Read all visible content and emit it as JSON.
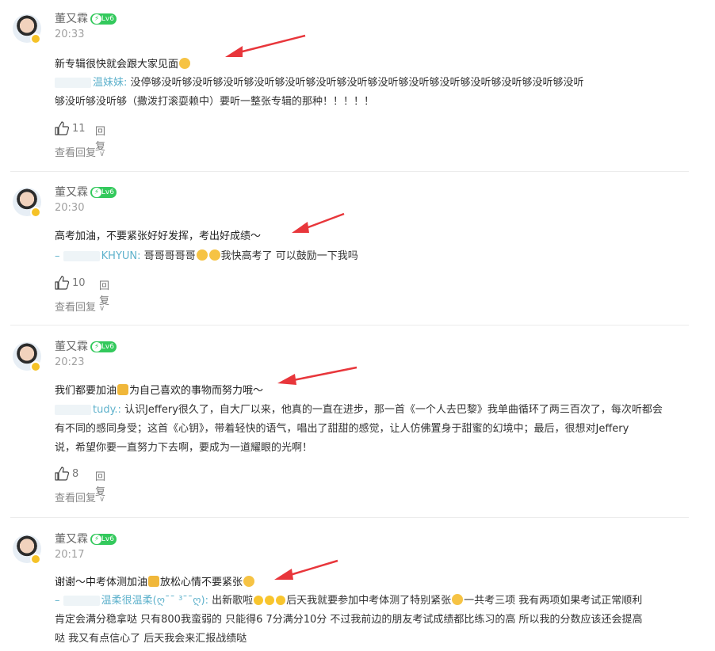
{
  "comments": [
    {
      "username": "董又霖",
      "level": "Lv6",
      "time": "20:33",
      "text": "新专辑很快就会跟大家见面",
      "reply_user": "温妹妹:",
      "reply_text_line1": "没停够没听够没听够没听够没听够没听够没听够没听够没听够没听够没听够没听够没听够没听够没听",
      "reply_text_line2": "够没听够没听够（撒泼打滚耍赖中）要听一整张专辑的那种！！！！！",
      "likes": "11",
      "reply_label": "回复",
      "view_replies": "查看回复"
    },
    {
      "username": "董又霖",
      "level": "Lv6",
      "time": "20:30",
      "text": "高考加油，不要紧张好好发挥，考出好成绩～",
      "reply_user": "KHYUN:",
      "reply_text": "哥哥哥哥哥",
      "reply_text_tail": "我快高考了 可以鼓励一下我吗",
      "likes": "10",
      "reply_label": "回复",
      "view_replies": "查看回复"
    },
    {
      "username": "董又霖",
      "level": "Lv6",
      "time": "20:23",
      "text_a": "我们都要加油",
      "text_b": "为自己喜欢的事物而努力哦～",
      "reply_user": "tudy.:",
      "reply_text_line1": "认识Jeffery很久了，自大厂以来，他真的一直在进步，那一首《一个人去巴黎》我单曲循环了两三百次了，每次听都会",
      "reply_text_line2": "有不同的感同身受；这首《心钥》，带着轻快的语气，唱出了甜甜的感觉，让人仿佛置身于甜蜜的幻境中；最后，很想对Jeffery",
      "reply_text_line3": "说，希望你要一直努力下去啊，要成为一道耀眼的光啊！",
      "likes": "8",
      "reply_label": "回复",
      "view_replies": "查看回复"
    },
    {
      "username": "董又霖",
      "level": "Lv6",
      "time": "20:17",
      "text_a": "谢谢～中考体测加油",
      "text_b": "放松心情不要紧张",
      "reply_user": "温柔很温柔(ღ¯¯ ³¯¯ღ):",
      "reply_text_a": "出新歌啦",
      "reply_text_b": "后天我就要参加中考体测了特别紧张",
      "reply_text_c": "一共考三项 我有两项如果考试正常顺利",
      "reply_text_line2": "肯定会满分稳拿哒 只有800我蛮弱的 只能得6 7分满分10分 不过我前边的朋友考试成绩都比练习的高 所以我的分数应该还会提高",
      "reply_text_line3": "哒 我又有点信心了 后天我会来汇报战绩哒"
    }
  ],
  "colors": {
    "accent": "#33c95c",
    "reply_user": "#5fb2cc",
    "arrow": "#e8363b"
  }
}
